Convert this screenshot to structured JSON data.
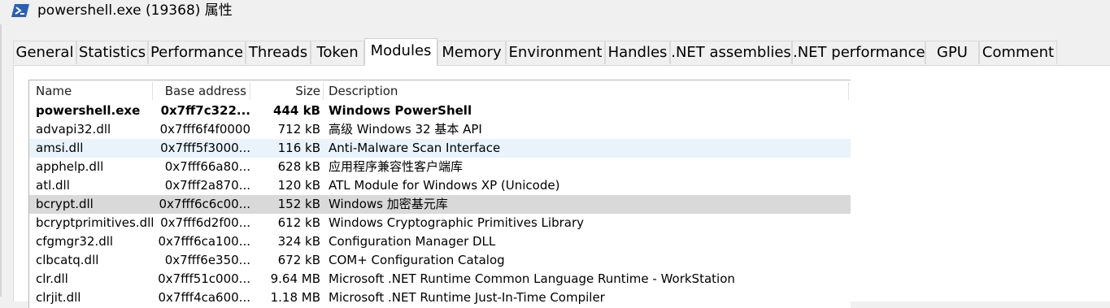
{
  "window": {
    "title": "powershell.exe (19368) 属性",
    "icon": "powershell-icon",
    "accent": "#2a5fb6"
  },
  "tabs": [
    {
      "label": "General",
      "active": false
    },
    {
      "label": "Statistics",
      "active": false
    },
    {
      "label": "Performance",
      "active": false
    },
    {
      "label": "Threads",
      "active": false
    },
    {
      "label": "Token",
      "active": false
    },
    {
      "label": "Modules",
      "active": true
    },
    {
      "label": "Memory",
      "active": false
    },
    {
      "label": "Environment",
      "active": false
    },
    {
      "label": "Handles",
      "active": false
    },
    {
      "label": ".NET assemblies",
      "active": false
    },
    {
      "label": ".NET performance",
      "active": false
    },
    {
      "label": "GPU",
      "active": false
    },
    {
      "label": "Comment",
      "active": false
    }
  ],
  "modules": {
    "columns": {
      "name": "Name",
      "base": "Base address",
      "size": "Size",
      "desc": "Description"
    },
    "rows": [
      {
        "name": "powershell.exe",
        "base": "0x7ff7c322...",
        "size": "444 kB",
        "desc": "Windows PowerShell",
        "style": "bold"
      },
      {
        "name": "advapi32.dll",
        "base": "0x7fff6f4f0000",
        "size": "712 kB",
        "desc": "高级 Windows 32 基本 API",
        "style": ""
      },
      {
        "name": "amsi.dll",
        "base": "0x7fff5f3000...",
        "size": "116 kB",
        "desc": "Anti-Malware Scan Interface",
        "style": "hl-blue"
      },
      {
        "name": "apphelp.dll",
        "base": "0x7fff66a80...",
        "size": "628 kB",
        "desc": "应用程序兼容性客户端库",
        "style": ""
      },
      {
        "name": "atl.dll",
        "base": "0x7fff2a870...",
        "size": "120 kB",
        "desc": "ATL Module for Windows XP (Unicode)",
        "style": ""
      },
      {
        "name": "bcrypt.dll",
        "base": "0x7fff6c6c00...",
        "size": "152 kB",
        "desc": "Windows 加密基元库",
        "style": "hl-gray"
      },
      {
        "name": "bcryptprimitives.dll",
        "base": "0x7fff6d2f00...",
        "size": "612 kB",
        "desc": "Windows Cryptographic Primitives Library",
        "style": ""
      },
      {
        "name": "cfgmgr32.dll",
        "base": "0x7fff6ca100...",
        "size": "324 kB",
        "desc": "Configuration Manager DLL",
        "style": ""
      },
      {
        "name": "clbcatq.dll",
        "base": "0x7fff6e350...",
        "size": "672 kB",
        "desc": "COM+ Configuration Catalog",
        "style": ""
      },
      {
        "name": "clr.dll",
        "base": "0x7fff51c000...",
        "size": "9.64 MB",
        "desc": "Microsoft .NET Runtime Common Language Runtime - WorkStation",
        "style": ""
      },
      {
        "name": "clrjit.dll",
        "base": "0x7fff4ca600...",
        "size": "1.18 MB",
        "desc": "Microsoft .NET Runtime Just-In-Time Compiler",
        "style": ""
      }
    ]
  }
}
